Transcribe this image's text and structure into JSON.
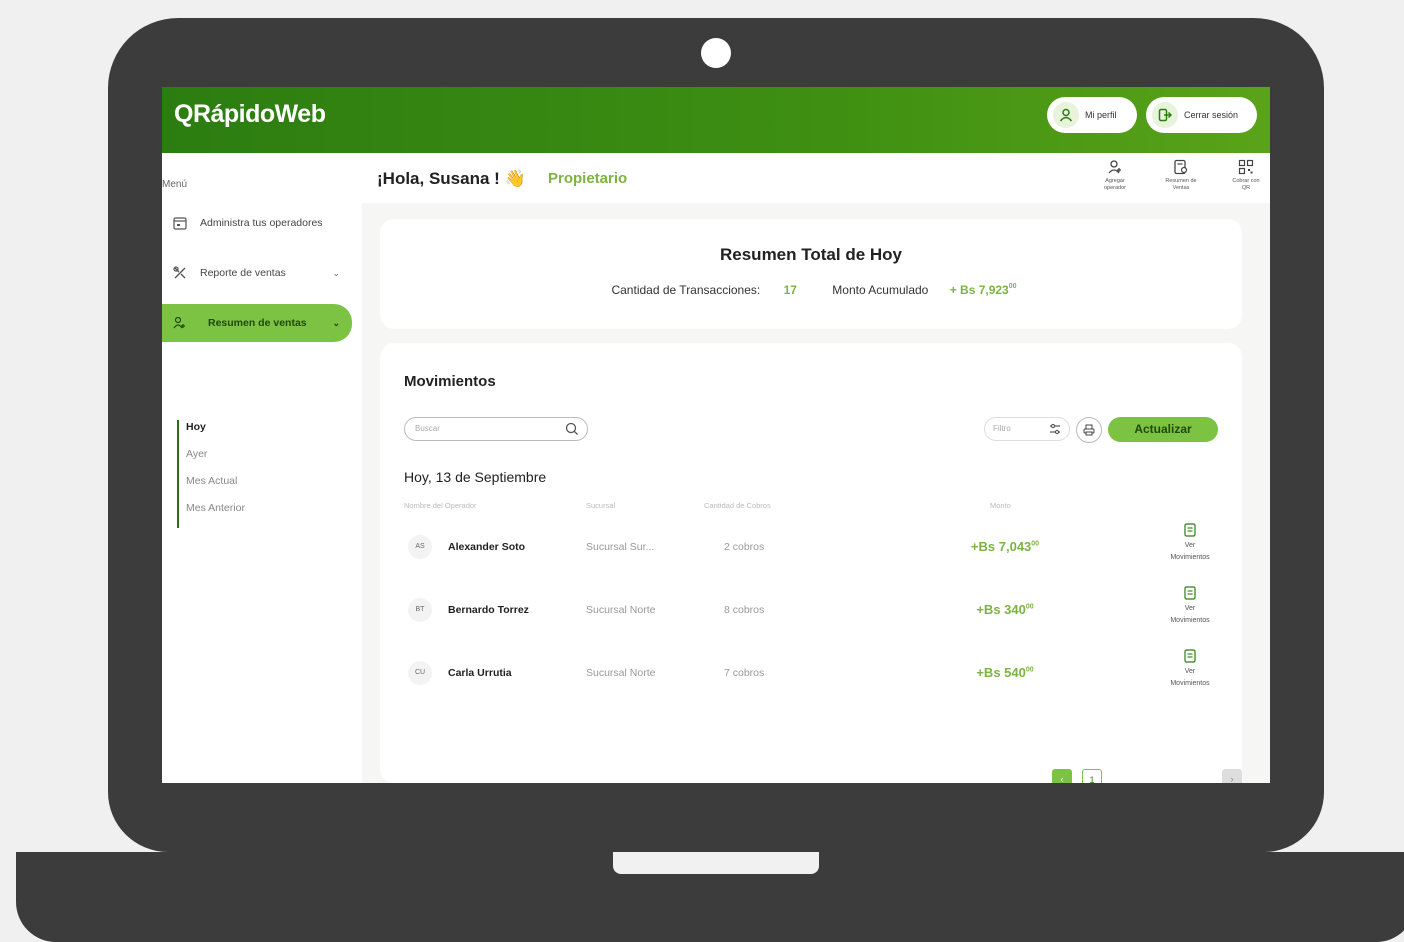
{
  "app": {
    "logo": "QRápidoWeb"
  },
  "header": {
    "profile_label": "Mi perfil",
    "logout_label": "Cerrar sesión"
  },
  "sidebar": {
    "menu_label": "Menú",
    "items": [
      {
        "label": "Administra tus operadores"
      },
      {
        "label": "Reporte de ventas"
      },
      {
        "label": "Resumen de ventas"
      }
    ],
    "subitems": [
      "Hoy",
      "Ayer",
      "Mes Actual",
      "Mes Anterior"
    ]
  },
  "greeting": {
    "text": "¡Hola, Susana ! 👋",
    "role": "Propietario"
  },
  "quick_actions": [
    {
      "line1": "Agregar",
      "line2": "operador"
    },
    {
      "line1": "Resumen de",
      "line2": "Ventas"
    },
    {
      "line1": "Cobrar con",
      "line2": "QR"
    }
  ],
  "summary": {
    "title": "Resumen Total de Hoy",
    "tx_label": "Cantidad de Transacciones:",
    "tx_value": "17",
    "amount_label": "Monto Acumulado",
    "amount_value": "+ Bs 7,923",
    "amount_cents": "00"
  },
  "movements": {
    "title": "Movimientos",
    "search_placeholder": "Buscar",
    "filter_placeholder": "Filtro",
    "refresh_label": "Actualizar",
    "date_header": "Hoy, 13 de Septiembre",
    "columns": [
      "Nombre del Operador",
      "Sucursal",
      "Cantidad de Cobros",
      "Monto"
    ],
    "view_line1": "Ver",
    "view_line2": "Movimientos",
    "rows": [
      {
        "initials": "AS",
        "name": "Alexander Soto",
        "branch": "Sucursal Sur...",
        "count": "2 cobros",
        "amount": "+Bs 7,043",
        "cents": "00"
      },
      {
        "initials": "BT",
        "name": "Bernardo Torrez",
        "branch": "Sucursal Norte",
        "count": "8 cobros",
        "amount": "+Bs 340",
        "cents": "00"
      },
      {
        "initials": "CU",
        "name": "Carla Urrutia",
        "branch": "Sucursal Norte",
        "count": "7 cobros",
        "amount": "+Bs 540",
        "cents": "00"
      }
    ]
  },
  "pagination": {
    "current_page": "1"
  },
  "colors": {
    "brand_green": "#2c7d11",
    "accent_green": "#7cc243",
    "amount_green": "#7cb342"
  }
}
